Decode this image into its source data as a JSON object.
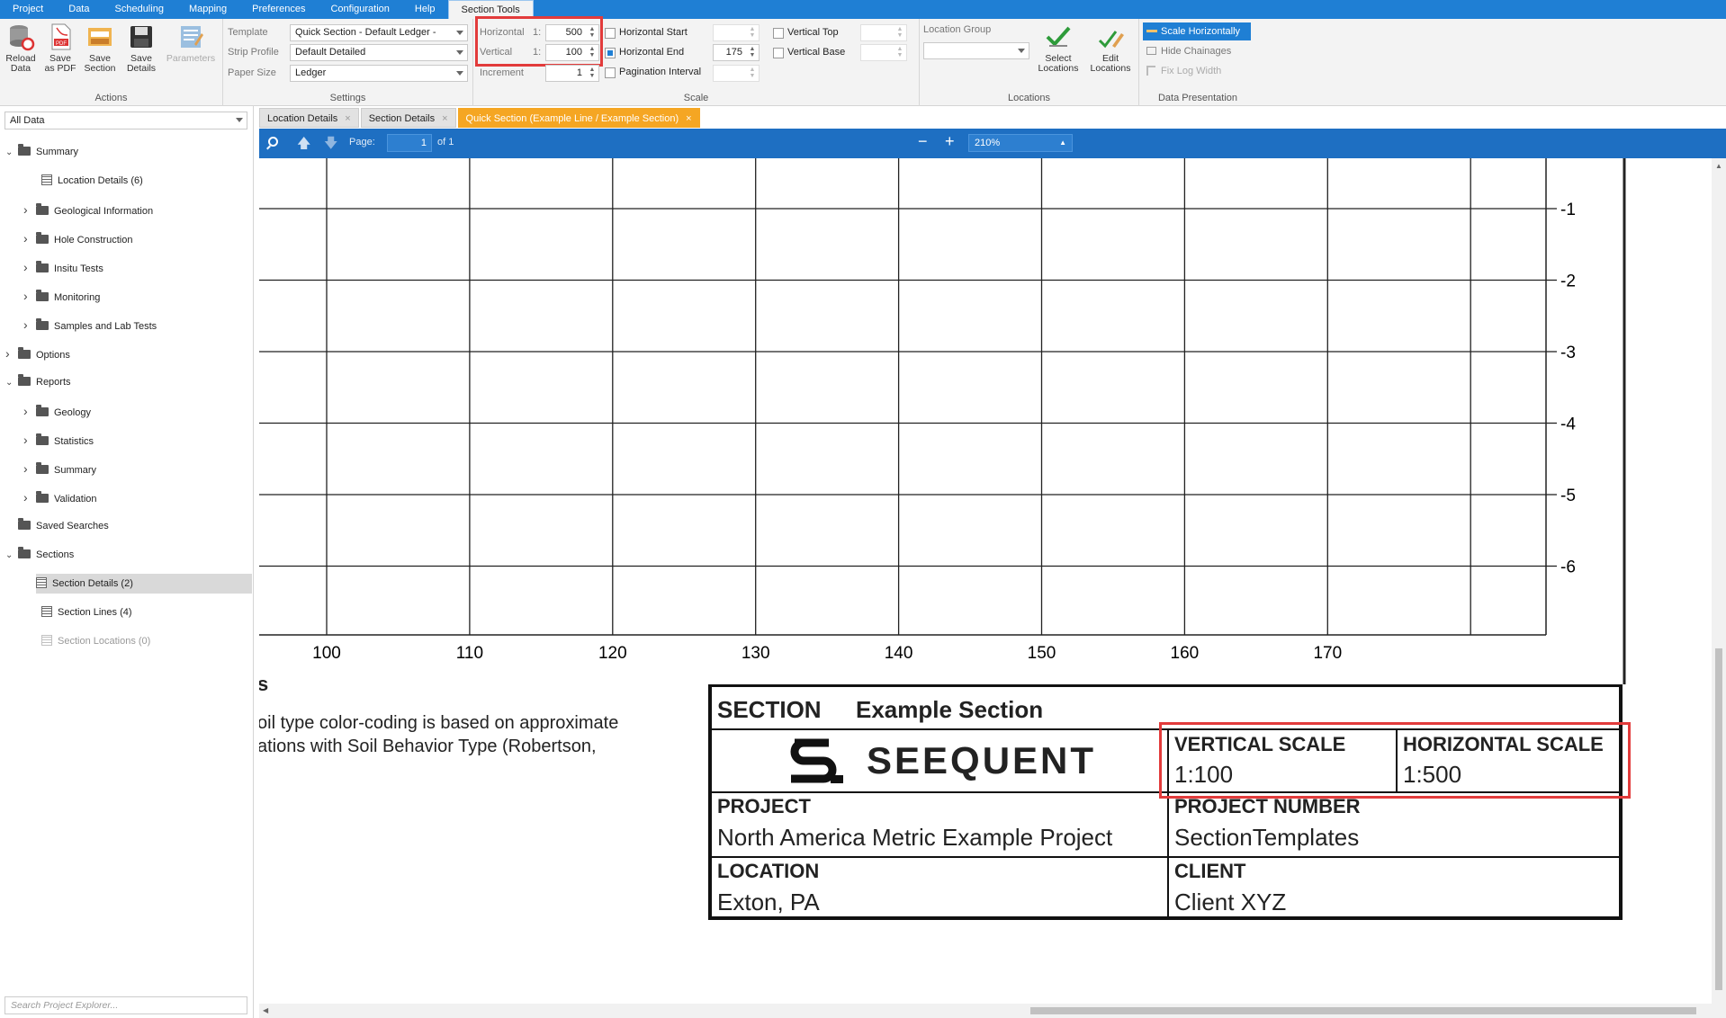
{
  "menu": [
    "Project",
    "Data",
    "Scheduling",
    "Mapping",
    "Preferences",
    "Configuration",
    "Help",
    "Section Tools"
  ],
  "ribbon": {
    "actions": {
      "buttons": [
        {
          "label1": "Reload",
          "label2": "Data"
        },
        {
          "label1": "Save",
          "label2": "as PDF"
        },
        {
          "label1": "Save",
          "label2": "Section"
        },
        {
          "label1": "Save",
          "label2": "Details"
        },
        {
          "label1": "Parameters",
          "label2": ""
        }
      ],
      "group_label": "Actions"
    },
    "settings": {
      "template_label": "Template",
      "template_value": "Quick Section - Default Ledger -",
      "strip_label": "Strip Profile",
      "strip_value": "Default Detailed",
      "paper_label": "Paper Size",
      "paper_value": "Ledger",
      "group_label": "Settings"
    },
    "scale": {
      "horizontal_label": "Horizontal",
      "vertical_label": "Vertical",
      "increment_label": "Increment",
      "ratio_prefix": "1:",
      "horizontal_value": "500",
      "vertical_value": "100",
      "increment_value": "1",
      "h_start_label": "Horizontal Start",
      "h_end_label": "Horizontal End",
      "h_end_value": "175",
      "pagination_label": "Pagination Interval",
      "v_top_label": "Vertical Top",
      "v_base_label": "Vertical Base",
      "group_label": "Scale"
    },
    "locations": {
      "location_group_label": "Location Group",
      "select_label1": "Select",
      "select_label2": "Locations",
      "edit_label1": "Edit",
      "edit_label2": "Locations",
      "group_label": "Locations"
    },
    "data_presentation": {
      "scale_horizontally": "Scale Horizontally",
      "hide_chainages": "Hide Chainages",
      "fix_log_width": "Fix Log Width",
      "group_label": "Data Presentation"
    }
  },
  "explorer": {
    "filter": "All Data",
    "search_placeholder": "Search Project Explorer...",
    "tree": [
      {
        "label": "Summary",
        "level": 0,
        "type": "folder",
        "expanded": true
      },
      {
        "label": "Location Details (6)",
        "level": 1,
        "type": "table"
      },
      {
        "label": "Geological Information",
        "level": 1,
        "type": "folder",
        "expanded": false
      },
      {
        "label": "Hole Construction",
        "level": 1,
        "type": "folder",
        "expanded": false
      },
      {
        "label": "Insitu Tests",
        "level": 1,
        "type": "folder",
        "expanded": false
      },
      {
        "label": "Monitoring",
        "level": 1,
        "type": "folder",
        "expanded": false
      },
      {
        "label": "Samples and Lab Tests",
        "level": 1,
        "type": "folder",
        "expanded": false
      },
      {
        "label": "Options",
        "level": 0,
        "type": "folder",
        "expanded": false
      },
      {
        "label": "Reports",
        "level": 0,
        "type": "folder",
        "expanded": true
      },
      {
        "label": "Geology",
        "level": 1,
        "type": "folder",
        "expanded": false
      },
      {
        "label": "Statistics",
        "level": 1,
        "type": "folder",
        "expanded": false
      },
      {
        "label": "Summary",
        "level": 1,
        "type": "folder",
        "expanded": false
      },
      {
        "label": "Validation",
        "level": 1,
        "type": "folder",
        "expanded": false
      },
      {
        "label": "Saved Searches",
        "level": 0,
        "type": "folder",
        "expanded": null
      },
      {
        "label": "Sections",
        "level": 0,
        "type": "folder",
        "expanded": true
      },
      {
        "label": "Section Details (2)",
        "level": 1,
        "type": "table",
        "selected": true
      },
      {
        "label": "Section Lines (4)",
        "level": 1,
        "type": "table"
      },
      {
        "label": "Section Locations (0)",
        "level": 1,
        "type": "table",
        "disabled": true
      }
    ]
  },
  "tabs": [
    {
      "label": "Location Details",
      "active": false
    },
    {
      "label": "Section Details",
      "active": false
    },
    {
      "label": "Quick Section (Example Line / Example Section)",
      "active": true
    }
  ],
  "viewer": {
    "page_label": "Page:",
    "page_value": "1",
    "page_of": "of 1",
    "zoom": "210%"
  },
  "section": {
    "x_ticks": [
      "100",
      "110",
      "120",
      "130",
      "140",
      "150",
      "160",
      "170"
    ],
    "y_ticks": [
      "-1",
      "-2",
      "-3",
      "-4",
      "-5",
      "-6"
    ],
    "notes_heading": "s",
    "notes_line1": "oil type color-coding is based on approximate",
    "notes_line2": "ations with Soil Behavior Type (Robertson,",
    "title_key": "SECTION",
    "title_value": "Example Section",
    "logo_text": "SEEQUENT",
    "vertical_scale_label": "VERTICAL SCALE",
    "vertical_scale_value": "1:100",
    "horizontal_scale_label": "HORIZONTAL SCALE",
    "horizontal_scale_value": "1:500",
    "project_label": "PROJECT",
    "project_value": "North America Metric Example Project",
    "project_number_label": "PROJECT NUMBER",
    "project_number_value": "SectionTemplates",
    "location_label": "LOCATION",
    "location_value": "Exton, PA",
    "client_label": "CLIENT",
    "client_value": "Client XYZ"
  },
  "colors": {
    "accent": "#1f7fd4",
    "tab_active": "#f5a623",
    "highlight": "#e23b3b"
  }
}
